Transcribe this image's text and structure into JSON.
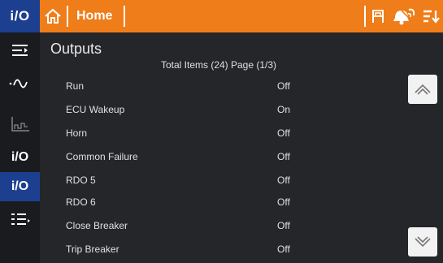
{
  "topbar": {
    "brand": "i/O",
    "home_title": "Home",
    "icons": [
      "home-icon",
      "operator-icon",
      "alarm-icon",
      "sort-icon"
    ],
    "colors": {
      "bar": "#ef7d1a",
      "brand_bg": "#1d3f8f"
    }
  },
  "sidebar": {
    "items": [
      {
        "icon": "menu-collapse-icon"
      },
      {
        "icon": "waveform-icon"
      },
      {
        "icon": "trend-chart-icon"
      },
      {
        "icon": "inputs-icon",
        "label": "i/O"
      },
      {
        "icon": "outputs-icon",
        "label": "i/O",
        "active": true
      },
      {
        "icon": "list-menu-icon"
      }
    ]
  },
  "main": {
    "title": "Outputs",
    "page_info": "Total Items (24) Page (1/3)",
    "rows": [
      {
        "name": "Run",
        "value": "Off"
      },
      {
        "name": "ECU Wakeup",
        "value": "On"
      },
      {
        "name": "Horn",
        "value": "Off"
      },
      {
        "name": "Common Failure",
        "value": "Off"
      },
      {
        "name": "RDO 5",
        "value": "Off"
      },
      {
        "name": "RDO 6",
        "value": "Off"
      },
      {
        "name": "Close Breaker",
        "value": "Off"
      },
      {
        "name": "Trip Breaker",
        "value": "Off"
      }
    ],
    "scroll": {
      "up_icon": "chevron-up-icon",
      "down_icon": "chevron-down-icon"
    }
  }
}
